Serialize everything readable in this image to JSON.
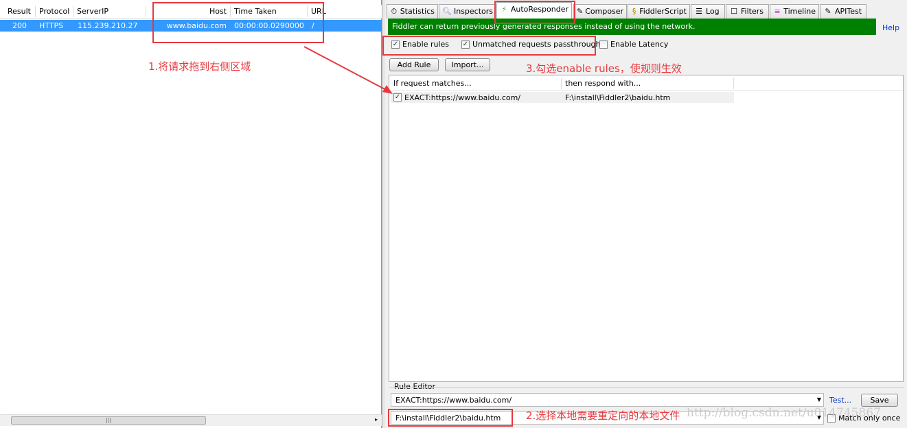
{
  "sessions": {
    "columns": [
      "Result",
      "Protocol",
      "ServerIP",
      "Host",
      "Time Taken",
      "URL"
    ],
    "rows": [
      {
        "result": "200",
        "protocol": "HTTPS",
        "server_ip": "115.239.210.27",
        "host": "www.baidu.com",
        "time_taken": "00:00:00.0290000",
        "url": "/"
      }
    ],
    "selected_color": "#3399ff"
  },
  "tabs": [
    {
      "label": "Statistics",
      "icon": "stopwatch-icon"
    },
    {
      "label": "Inspectors",
      "icon": "magnifier-icon"
    },
    {
      "label": "AutoResponder",
      "icon": "lightning-icon",
      "active": true
    },
    {
      "label": "Composer",
      "icon": "pencil-icon"
    },
    {
      "label": "FiddlerScript",
      "icon": "script-icon"
    },
    {
      "label": "Log",
      "icon": "log-icon"
    },
    {
      "label": "Filters",
      "icon": "checkbox-icon"
    },
    {
      "label": "Timeline",
      "icon": "timeline-icon"
    },
    {
      "label": "APITest",
      "icon": "pencil-icon"
    }
  ],
  "autoresponder": {
    "banner": "Fiddler can return previously generated responses instead of using the network.",
    "banner_color": "#008000",
    "help": "Help",
    "enable_rules": {
      "label": "Enable rules",
      "checked": true
    },
    "passthrough": {
      "label": "Unmatched requests passthrough",
      "checked": true
    },
    "latency": {
      "label": "Enable Latency",
      "checked": false
    },
    "add_rule": "Add Rule",
    "import": "Import...",
    "list_columns": [
      "If request matches...",
      "then respond with..."
    ],
    "rules": [
      {
        "match": "EXACT:https://www.baidu.com/",
        "respond": "F:\\install\\Fiddler2\\baidu.htm",
        "checked": true
      }
    ],
    "rule_editor": {
      "label": "Rule Editor",
      "match_value": "EXACT:https://www.baidu.com/",
      "respond_value": "F:\\install\\Fiddler2\\baidu.htm",
      "test": "Test...",
      "save": "Save",
      "match_once": {
        "label": "Match only once",
        "checked": false
      }
    }
  },
  "annotations": {
    "step1": "1.将请求拖到右侧区域",
    "step2": "2.选择本地需要重定向的本地文件",
    "step3": "3.勾选enable rules，使规则生效",
    "color": "#e8383d"
  },
  "watermark": "http://blog.csdn.net/u014745867"
}
